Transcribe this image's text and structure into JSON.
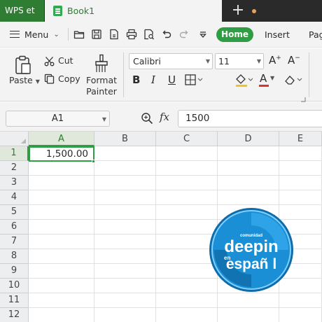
{
  "tabs": {
    "app_label": "WPS et",
    "doc_label": "Book1",
    "new_tab_symbol": "+"
  },
  "menu": {
    "menu_label": "Menu",
    "ribbon_tabs": [
      "Home",
      "Insert",
      "Pag"
    ],
    "active_tab": "Home"
  },
  "ribbon": {
    "paste_label": "Paste",
    "cut_label": "Cut",
    "copy_label": "Copy",
    "format_painter_label": [
      "Format",
      "Painter"
    ],
    "font_name": "Calibri",
    "font_size": "11",
    "bold_label": "B",
    "italic_label": "I",
    "underline_label": "U",
    "font_color_label": "A",
    "accent_colors": {
      "highlight": "#f0c419",
      "font_color": "#e0322d"
    }
  },
  "formula_bar": {
    "name_box": "A1",
    "fx_label": "fx",
    "value": "1500"
  },
  "sheet": {
    "columns": [
      "A",
      "B",
      "C",
      "D",
      "E"
    ],
    "rows": [
      "1",
      "2",
      "3",
      "4",
      "5",
      "6",
      "7",
      "8",
      "9",
      "10",
      "11",
      "12"
    ],
    "active_cell": "A1",
    "cell_a1_display": "1,500.00"
  },
  "watermark": {
    "line_small": "comunidad",
    "line1": "deepin",
    "line2": "en",
    "line3": "españ l"
  },
  "colors": {
    "accent_green": "#2e9d44",
    "tab_green": "#2e7d32",
    "titlebar": "#2a2a2a",
    "logo_blue": "#1b8fd6"
  }
}
